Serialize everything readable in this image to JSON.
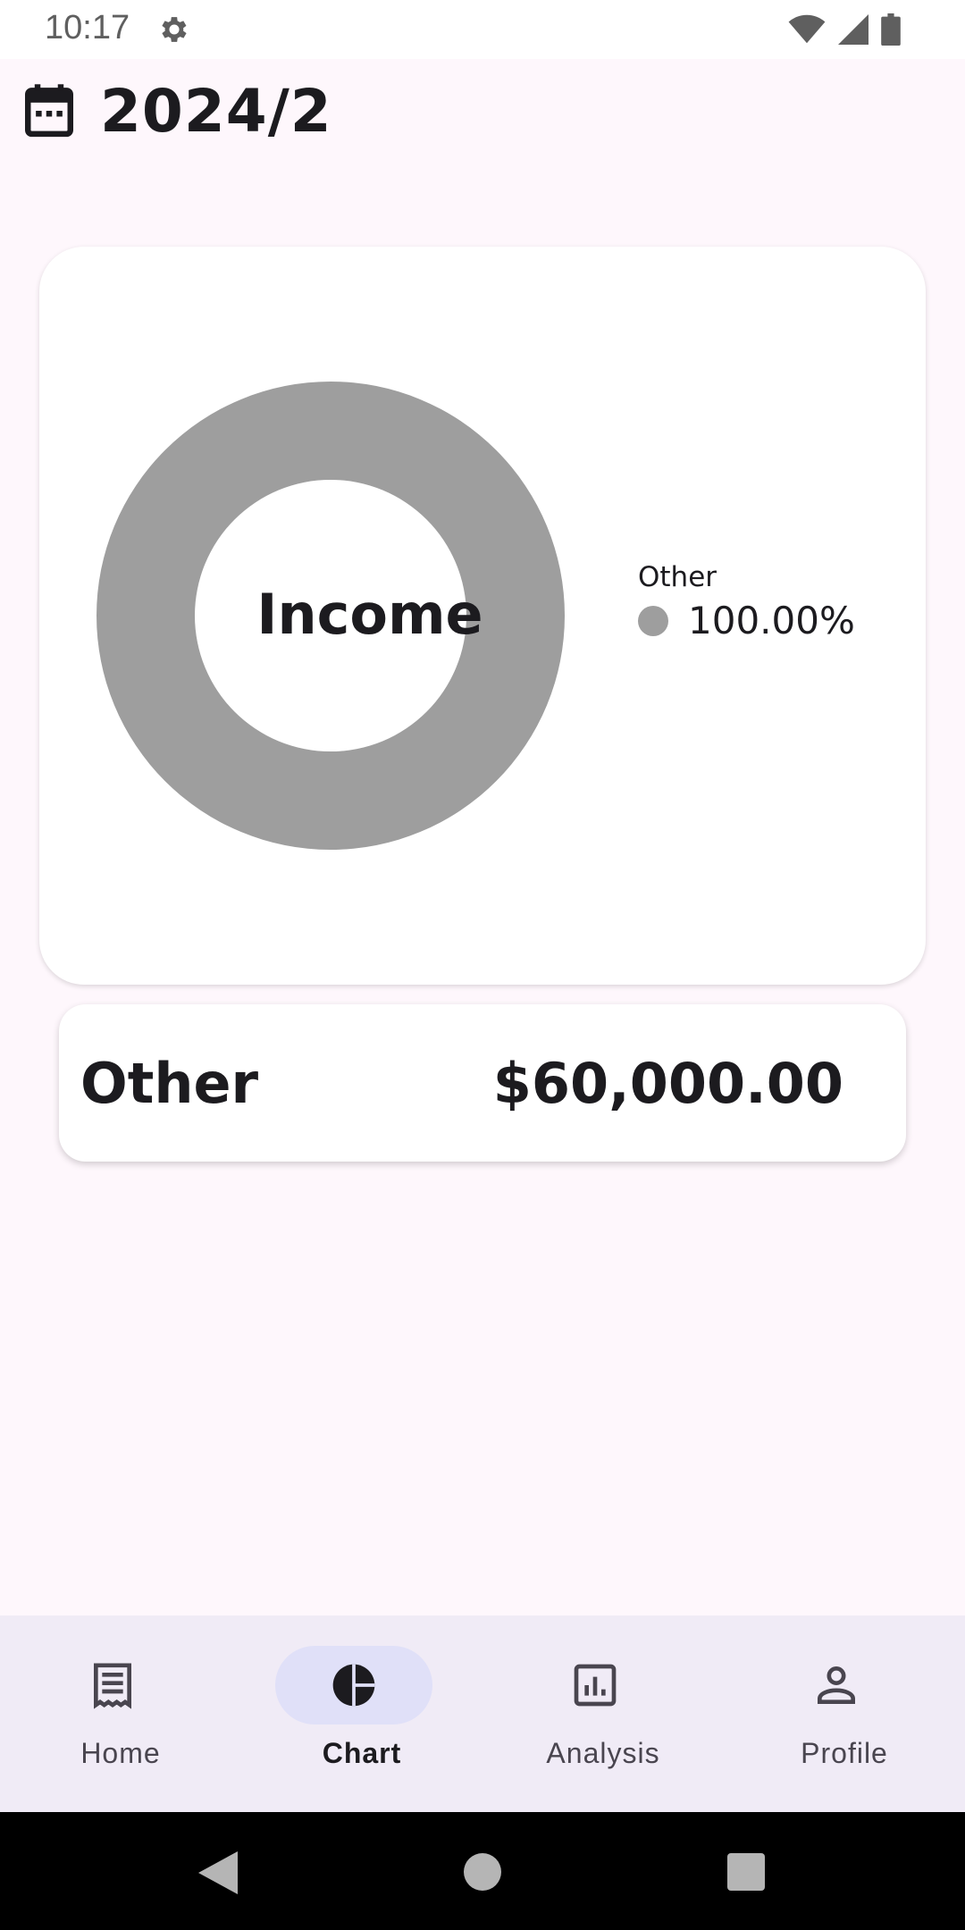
{
  "status_bar": {
    "time": "10:17",
    "icons": [
      "gear-icon",
      "wifi-icon",
      "signal-icon",
      "battery-icon"
    ]
  },
  "header": {
    "icon": "calendar-icon",
    "title": "2024/2"
  },
  "chart_data": {
    "type": "pie",
    "center_label": "Income",
    "slices": [
      {
        "name": "Other",
        "value": 100.0,
        "label": "100.00%",
        "color": "#9e9e9e"
      }
    ]
  },
  "summary": {
    "name": "Other",
    "amount": "$60,000.00"
  },
  "bottom_nav": {
    "items": [
      {
        "label": "Home",
        "icon": "receipt-icon",
        "active": false
      },
      {
        "label": "Chart",
        "icon": "pie-chart-icon",
        "active": true
      },
      {
        "label": "Analysis",
        "icon": "bar-chart-icon",
        "active": false
      },
      {
        "label": "Profile",
        "icon": "person-icon",
        "active": false
      }
    ]
  },
  "colors": {
    "background": "#fef7fc",
    "accent_pill": "#e0e0f8",
    "nav_bg": "#f0ebf6",
    "slice": "#9e9e9e"
  }
}
